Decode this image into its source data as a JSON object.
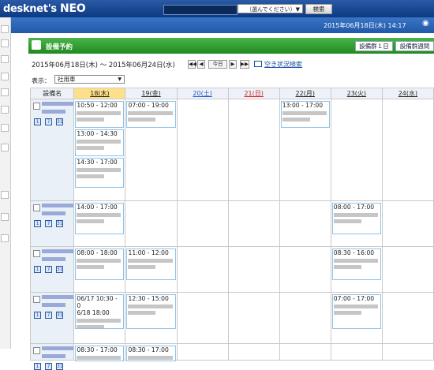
{
  "app": {
    "logo": "desknet's",
    "logo_suffix": "NEO"
  },
  "topbar": {
    "select_label": "（選んでください）",
    "search_button": "検索"
  },
  "datebar": {
    "datetime": "2015年06月18日(木) 14:17"
  },
  "page": {
    "title": "設備予約",
    "button_group": "設備群１日",
    "button_week": "設備群週間",
    "range": "2015年06月18日(木) ～ 2015年06月24日(水)",
    "today_btn": "今日",
    "availability_search": "空き状況検索",
    "display_label": "表示：",
    "display_value": "社用車"
  },
  "grid": {
    "resource_header": "設備名",
    "days": [
      {
        "label": "18(木)",
        "kind": "today"
      },
      {
        "label": "19(金)",
        "kind": "normal"
      },
      {
        "label": "20(土)",
        "kind": "sat"
      },
      {
        "label": "21(日)",
        "kind": "sun"
      },
      {
        "label": "22(月)",
        "kind": "normal"
      },
      {
        "label": "23(火)",
        "kind": "normal"
      },
      {
        "label": "24(水)",
        "kind": "normal"
      }
    ],
    "rows": [
      {
        "events": [
          {
            "day": 0,
            "time": "10:50 - 12:00"
          },
          {
            "day": 0,
            "time": "13:00 - 14:30"
          },
          {
            "day": 0,
            "time": "14:30 - 17:00"
          },
          {
            "day": 1,
            "time": "07:00 - 19:00"
          },
          {
            "day": 4,
            "time": "13:00 - 17:00"
          }
        ]
      },
      {
        "events": [
          {
            "day": 0,
            "time": "14:00 - 17:00"
          },
          {
            "day": 5,
            "time": "08:00 - 17:00"
          }
        ]
      },
      {
        "events": [
          {
            "day": 0,
            "time": "08:00 - 18:00"
          },
          {
            "day": 1,
            "time": "11:00 - 12:00"
          },
          {
            "day": 5,
            "time": "08:30 - 16:00"
          }
        ]
      },
      {
        "events": [
          {
            "day": 0,
            "time": "06/17 10:30 - 0",
            "time2": "6/18 18:00"
          },
          {
            "day": 1,
            "time": "12:30 - 15:00"
          },
          {
            "day": 5,
            "time": "07:00 - 17:00"
          }
        ]
      },
      {
        "events": [
          {
            "day": 0,
            "time": "08:30 - 17:00"
          },
          {
            "day": 1,
            "time": "08:30 - 17:00"
          }
        ]
      }
    ]
  },
  "icons": {
    "calendar_day": "1",
    "calendar_week": "7",
    "calendar_month": "31"
  }
}
